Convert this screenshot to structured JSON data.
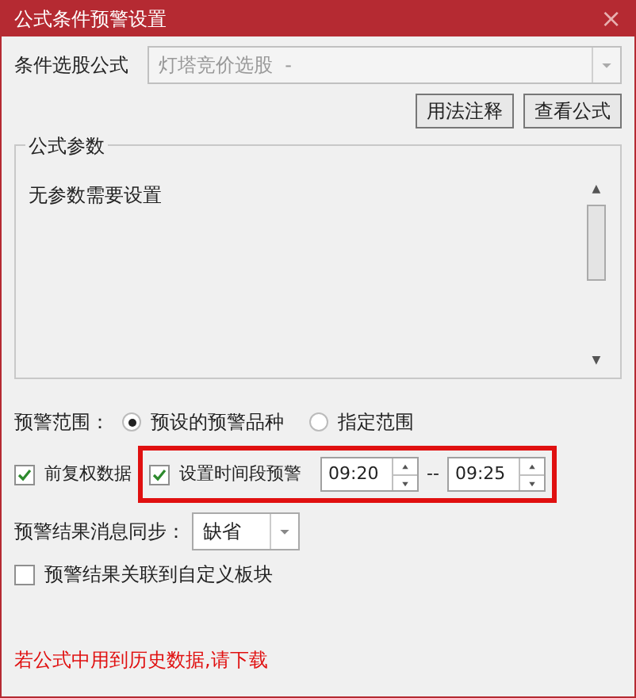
{
  "window": {
    "title": "公式条件预警设置",
    "close": "×"
  },
  "formula": {
    "label": "条件选股公式",
    "value": "灯塔竞价选股  -",
    "disabled": true
  },
  "buttons": [
    "用法注释",
    "查看公式"
  ],
  "params": {
    "title": "公式参数",
    "text": "无参数需要设置",
    "scroll_arrows": [
      "▲",
      "▼"
    ]
  },
  "range": {
    "label": "预警范围：",
    "options": [
      {
        "label": "预设的预警品种",
        "selected": true
      },
      {
        "label": "指定范围",
        "selected": false
      }
    ]
  },
  "adjusted": {
    "label": "前复权数据",
    "checked": true
  },
  "time_alert": {
    "label": "设置时间段预警",
    "checked": true,
    "highlighted": true,
    "start": "09:20",
    "separator": "--",
    "end": "09:25"
  },
  "sync": {
    "label": "预警结果消息同步：",
    "value": "缺省"
  },
  "link_block": {
    "label": "预警结果关联到自定义板块",
    "checked": false
  },
  "note": "若公式中用到历史数据,请下载"
}
